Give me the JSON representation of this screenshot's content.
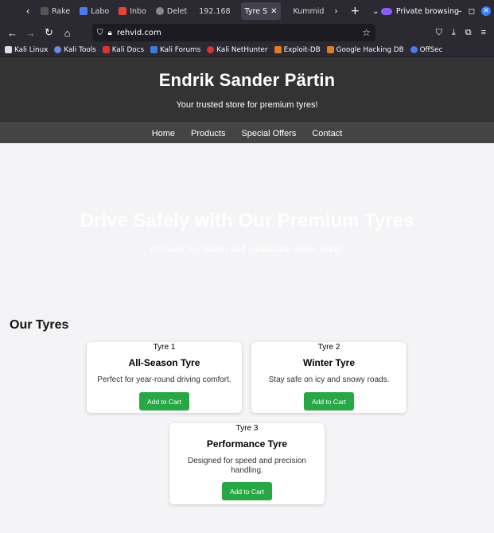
{
  "browser": {
    "tabs": [
      {
        "title": "Rake",
        "color": "#555"
      },
      {
        "title": "Labo",
        "color": "#4a7cf0"
      },
      {
        "title": "Inbo",
        "color": "#ea4335"
      },
      {
        "title": "Delet",
        "color": "#888"
      },
      {
        "title": "192.168",
        "color": "#2b2a33"
      },
      {
        "title": "Tyre S",
        "color": "#2b2a33",
        "active": true
      },
      {
        "title": "Kummid",
        "color": "#2b2a33"
      }
    ],
    "private_label": "Private browsing",
    "url": "rehvid.com",
    "bookmarks": [
      {
        "label": "Kali Linux",
        "color": "#e0e0e0"
      },
      {
        "label": "Kali Tools",
        "color": "#6a8ad8"
      },
      {
        "label": "Kali Docs",
        "color": "#d33"
      },
      {
        "label": "Kali Forums",
        "color": "#3b7de0"
      },
      {
        "label": "Kali NetHunter",
        "color": "#d33"
      },
      {
        "label": "Exploit-DB",
        "color": "#e07b2a"
      },
      {
        "label": "Google Hacking DB",
        "color": "#e07b2a"
      },
      {
        "label": "OffSec",
        "color": "#4a7cf0"
      }
    ]
  },
  "site": {
    "title": "Endrik Sander Pärtin",
    "tagline": "Your trusted store for premium tyres!",
    "nav": [
      "Home",
      "Products",
      "Special Offers",
      "Contact"
    ],
    "hero_title": "Drive Safely with Our Premium Tyres",
    "hero_sub": "Discover top brands and unbeatable prices today!",
    "section_title": "Our Tyres",
    "products": [
      {
        "image_alt": "Tyre 1",
        "name": "All-Season Tyre",
        "desc": "Perfect for year-round driving comfort.",
        "button": "Add to Cart"
      },
      {
        "image_alt": "Tyre 2",
        "name": "Winter Tyre",
        "desc": "Stay safe on icy and snowy roads.",
        "button": "Add to Cart"
      },
      {
        "image_alt": "Tyre 3",
        "name": "Performance Tyre",
        "desc": "Designed for speed and precision handling.",
        "button": "Add to Cart"
      }
    ]
  },
  "colors": {
    "header_bg": "#333333",
    "nav_bg": "#444444",
    "button_bg": "#28a745"
  }
}
